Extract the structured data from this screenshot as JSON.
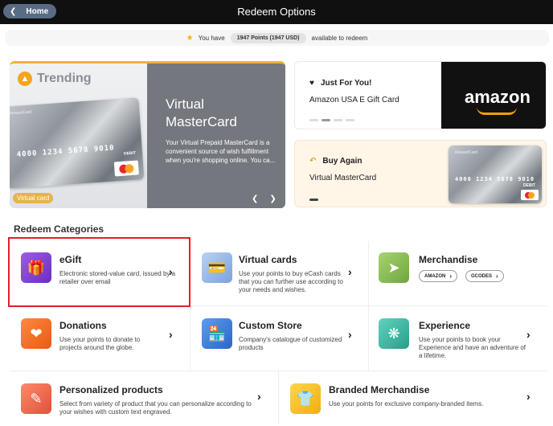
{
  "header": {
    "home_label": "Home",
    "title": "Redeem Options"
  },
  "points": {
    "prefix": "You have",
    "amount": "1947 Points (1947 USD)",
    "suffix": "available to redeem"
  },
  "trending": {
    "title": "Trending",
    "badge": "Virtual card",
    "product": "Virtual\nMasterCard",
    "product_line1": "Virtual",
    "product_line2": "MasterCard",
    "description": "Your Virtual Prepaid MasterCard is a convenient source of wish fulfillment when you're shopping online. You ca..."
  },
  "card_art": {
    "brand": "RewardCard",
    "number": "4000 1234 5678 9010",
    "type": "DEBIT"
  },
  "just_for_you": {
    "title": "Just For You!",
    "subtitle": "Amazon USA E Gift Card",
    "tile_text": "amazon"
  },
  "buy_again": {
    "title": "Buy Again",
    "subtitle": "Virtual MasterCard"
  },
  "categories_heading": "Redeem Categories",
  "categories": [
    {
      "title": "eGift",
      "desc": "Electronic stored-value card, issued by a retailer over email"
    },
    {
      "title": "Virtual cards",
      "desc": "Use your points to buy eCash cards that you can further use according to your needs and wishes."
    },
    {
      "title": "Merchandise",
      "tags": [
        "AMAZON",
        "GCODES"
      ]
    },
    {
      "title": "Donations",
      "desc": "Use your points to donate to projects around the globe."
    },
    {
      "title": "Custom Store",
      "desc": "Company's catalogue of customized products"
    },
    {
      "title": "Experience",
      "desc": "Use your points to book your Experience and have an adventure of a lifetime."
    },
    {
      "title": "Personalized products",
      "desc": "Select from variety of product that you can personalize according to your wishes with custom text engraved."
    },
    {
      "title": "Branded Merchandise",
      "desc": "Use your points for exclusive company-branded items."
    }
  ],
  "colors": {
    "trending_accent": "#f2b233",
    "egift_icon": "#7e3fc9",
    "donations_icon": "#f26b1d",
    "custom_store_icon": "#3d7bd9",
    "experience_icon": "#3bb6a3",
    "personalized_icon": "#f0654f",
    "branded_icon": "#f6c21e",
    "merch_icon": "#8ec05a",
    "virtual_cards_icon": "#8fb3e6",
    "highlight": "#e0202a"
  }
}
